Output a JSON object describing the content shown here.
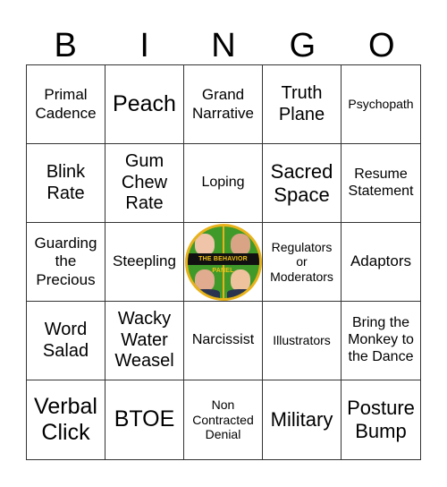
{
  "title_letters": [
    "B",
    "I",
    "N",
    "G",
    "O"
  ],
  "cells": [
    "Primal Cadence",
    "Peach",
    "Grand Narrative",
    "Truth Plane",
    "Psychopath",
    "Blink Rate",
    "Gum Chew Rate",
    "Loping",
    "Sacred Space",
    "Resume Statement",
    "Guarding the Precious",
    "Steepling",
    "",
    "Regulators or Moderators",
    "Adaptors",
    "Word Salad",
    "Wacky Water Weasel",
    "Narcissist",
    "Illustrators",
    "Bring the Monkey to the Dance",
    "Verbal Click",
    "BTOE",
    "Non Contracted Denial",
    "Military",
    "Posture Bump"
  ],
  "free_space": {
    "logo_text": "THE BEHAVIOR PANEL",
    "colors": {
      "ring": "#e8b21a",
      "background": "#3f9a2a",
      "banner": "#111111",
      "banner_text": "#f3c317"
    }
  }
}
